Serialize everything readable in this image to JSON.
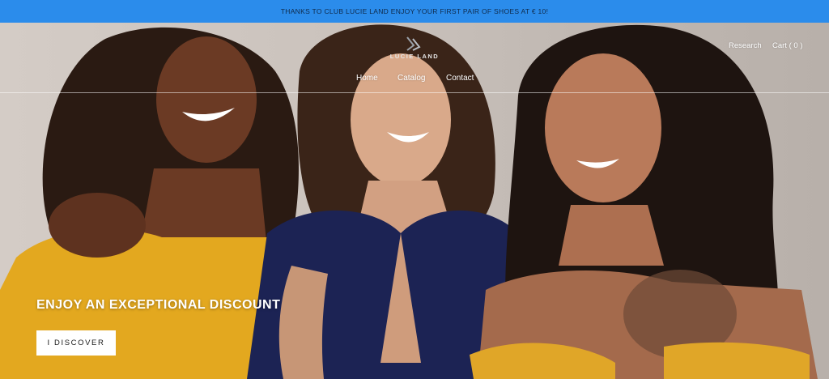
{
  "announcement": {
    "text": "THANKS TO CLUB LUCIE LAND ENJOY YOUR FIRST PAIR OF SHOES AT € 10!"
  },
  "header": {
    "logo_text": "LUCIE LAND",
    "nav": [
      {
        "label": "Home"
      },
      {
        "label": "Catalog"
      },
      {
        "label": "Contact"
      }
    ],
    "research_label": "Research",
    "cart_label": "Cart",
    "cart_count": "( 0 )"
  },
  "hero": {
    "headline": "ENJOY AN EXCEPTIONAL DISCOUNT",
    "cta_label": "I DISCOVER",
    "image_subject": "three smiling women portrait"
  },
  "colors": {
    "announcement_bg": "#2b8ceb",
    "hero_bg": "#cbc3bd",
    "text_light": "#ffffff",
    "button_bg": "#ffffff"
  }
}
